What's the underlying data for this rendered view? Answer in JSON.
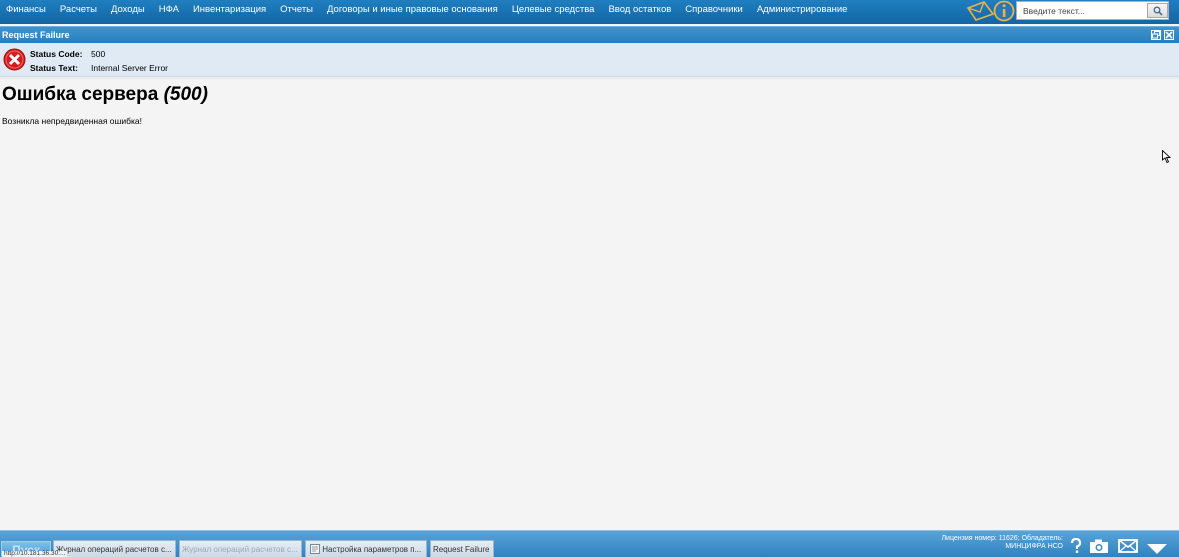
{
  "menu": {
    "items": [
      {
        "label": "Финансы"
      },
      {
        "label": "Расчеты"
      },
      {
        "label": "Доходы"
      },
      {
        "label": "НФА"
      },
      {
        "label": "Инвентаризация"
      },
      {
        "label": "Отчеты"
      },
      {
        "label": "Договоры и иные правовые основания"
      },
      {
        "label": "Целевые средства"
      },
      {
        "label": "Ввод остатков"
      },
      {
        "label": "Справочники"
      },
      {
        "label": "Администрирование"
      }
    ]
  },
  "search": {
    "placeholder": "Введите текст..."
  },
  "window": {
    "title": "Request Failure",
    "status_code_label": "Status Code:",
    "status_code_value": "500",
    "status_text_label": "Status Text:",
    "status_text_value": "Internal Server Error"
  },
  "error": {
    "title": "Ошибка сервера",
    "code": "(500)",
    "message": "Возникла непредвиденная ошибка!"
  },
  "taskbar": {
    "start_label": "Пуск",
    "tasks": [
      {
        "label": "Журнал операций расчетов с...",
        "dim": false
      },
      {
        "label": "Журнал операций расчетов с...",
        "dim": true
      },
      {
        "label": "Настройка параметров п...",
        "dim": false
      },
      {
        "label": "Request Failure",
        "dim": false
      }
    ],
    "license_line1": "Лицензия номер: 11626; Обладатель:",
    "license_line2": "МИНЦИФРА НСО",
    "status_url": "http://10.181.36.30:..."
  },
  "colors": {
    "menu_bar": "#1a73b5",
    "panel_header": "#2f85c4",
    "status_area": "#dfeaf4",
    "error_icon": "#d41c1c"
  },
  "icons": [
    "mail-icon",
    "info-icon",
    "search-icon",
    "restore-icon",
    "close-icon",
    "error-icon",
    "help-icon",
    "camera-icon",
    "envelope-icon",
    "arrow-down-icon"
  ]
}
